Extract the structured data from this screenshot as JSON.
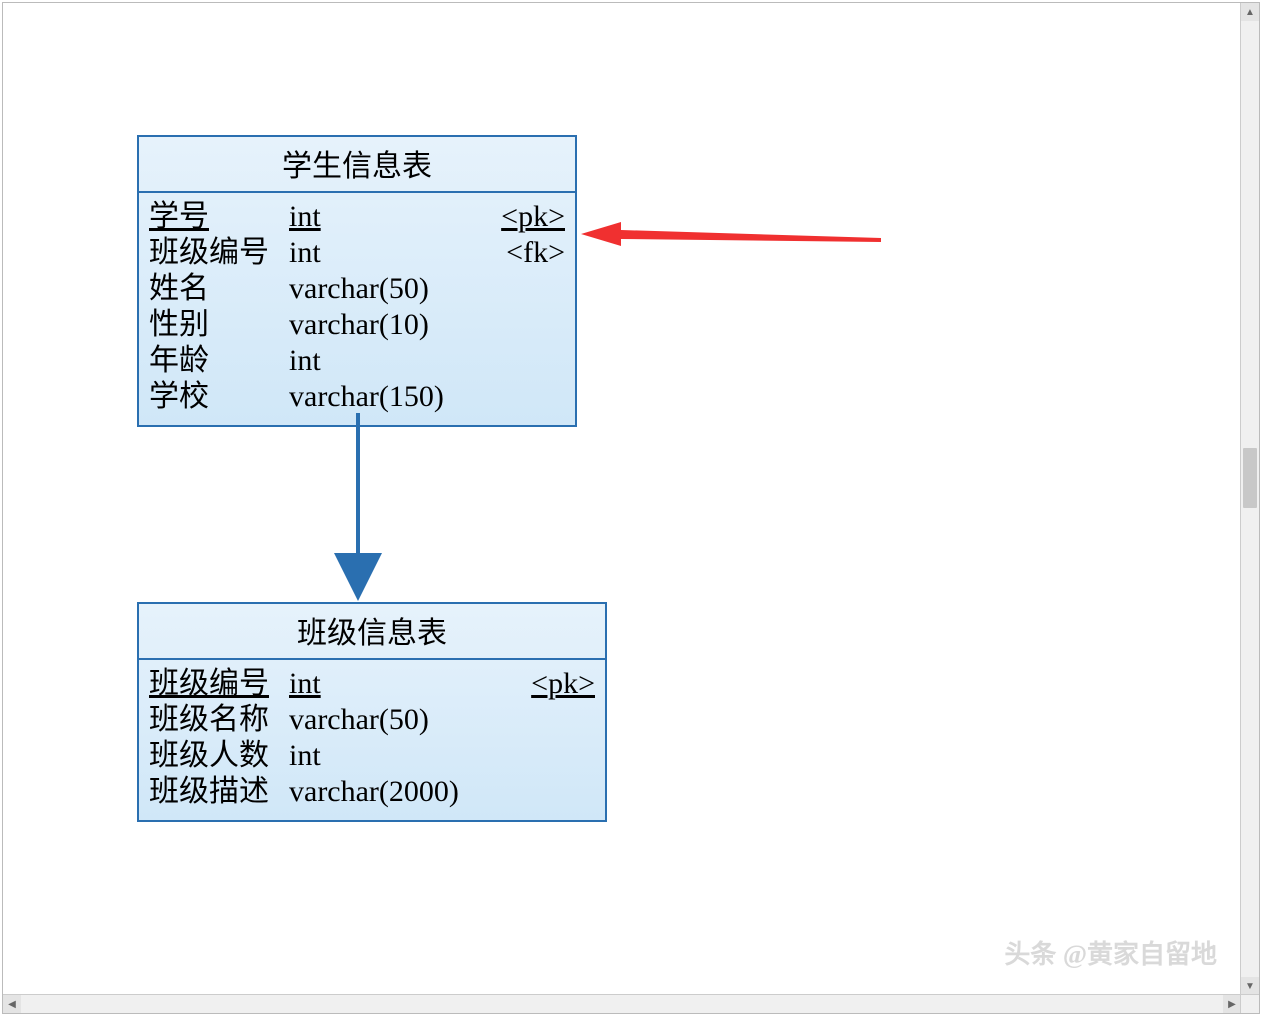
{
  "entities": {
    "student": {
      "title": "学生信息表",
      "columns": [
        {
          "name": "学号",
          "type": "int",
          "key": "<pk>",
          "pk": true
        },
        {
          "name": "班级编号",
          "type": "int",
          "key": "<fk>",
          "pk": false
        },
        {
          "name": "姓名",
          "type": "varchar(50)",
          "key": "",
          "pk": false
        },
        {
          "name": "性别",
          "type": "varchar(10)",
          "key": "",
          "pk": false
        },
        {
          "name": "年龄",
          "type": "int",
          "key": "",
          "pk": false
        },
        {
          "name": "学校",
          "type": "varchar(150)",
          "key": "",
          "pk": false
        }
      ]
    },
    "class": {
      "title": "班级信息表",
      "columns": [
        {
          "name": "班级编号",
          "type": "int",
          "key": "<pk>",
          "pk": true
        },
        {
          "name": "班级名称",
          "type": "varchar(50)",
          "key": "",
          "pk": false
        },
        {
          "name": "班级人数",
          "type": "int",
          "key": "",
          "pk": false
        },
        {
          "name": "班级描述",
          "type": "varchar(2000)",
          "key": "",
          "pk": false
        }
      ]
    }
  },
  "watermark": "头条 @黄家自留地",
  "colors": {
    "entity_border": "#2a6fb0",
    "entity_fill_top": "#e6f2fb",
    "entity_fill_bottom": "#d0e7f8",
    "relation_arrow": "#2a6fb0",
    "annotation_arrow": "#f03030"
  }
}
